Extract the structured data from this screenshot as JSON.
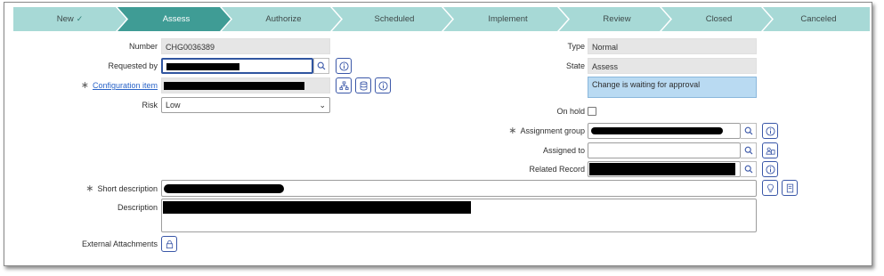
{
  "process_flow": {
    "stages": [
      {
        "label": "New",
        "completed": true
      },
      {
        "label": "Assess",
        "active": true
      },
      {
        "label": "Authorize"
      },
      {
        "label": "Scheduled"
      },
      {
        "label": "Implement"
      },
      {
        "label": "Review"
      },
      {
        "label": "Closed"
      },
      {
        "label": "Canceled"
      }
    ],
    "colors": {
      "inactive": "#a7d9d6",
      "active": "#3f9c95"
    }
  },
  "left": {
    "number_label": "Number",
    "number_value": "CHG0036389",
    "requested_by_label": "Requested by",
    "requested_by_value": "[redacted]",
    "configuration_item_label": "Configuration item",
    "configuration_item_value": "[redacted]",
    "risk_label": "Risk",
    "risk_value": "Low"
  },
  "right": {
    "type_label": "Type",
    "type_value": "Normal",
    "state_label": "State",
    "state_value": "Assess",
    "approval_message": "Change is waiting for approval",
    "on_hold_label": "On hold",
    "on_hold_checked": false,
    "assignment_group_label": "Assignment group",
    "assignment_group_value": "[redacted]",
    "assigned_to_label": "Assigned to",
    "assigned_to_value": "",
    "related_record_label": "Related Record",
    "related_record_value": "[redacted]"
  },
  "bottom": {
    "short_description_label": "Short description",
    "short_description_value": "[redacted]",
    "description_label": "Description",
    "description_value": "[redacted]",
    "external_attachments_label": "External Attachments"
  },
  "required_marker": "∗",
  "icons": {
    "search": "search-icon",
    "info": "info-icon",
    "hierarchy": "hierarchy-icon",
    "database": "database-icon",
    "people": "people-icon",
    "bulb": "lightbulb-icon",
    "book": "book-icon",
    "lock": "lock-icon"
  }
}
